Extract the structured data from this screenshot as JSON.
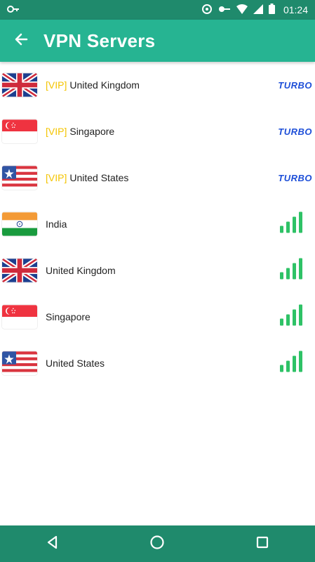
{
  "status_bar": {
    "time": "01:24",
    "icons": [
      "key-icon",
      "sync-icon",
      "vpn-key-icon",
      "wifi-icon",
      "signal-icon",
      "battery-icon"
    ]
  },
  "app_bar": {
    "title": "VPN Servers",
    "back_icon": "arrow-back-icon"
  },
  "colors": {
    "status_bar": "#1f8a6c",
    "app_bar": "#26b492",
    "vip": "#f4c400",
    "turbo": "#1e4fd8",
    "signal": "#2ec266"
  },
  "servers": [
    {
      "vip": "[VIP]",
      "name": "United Kingdom",
      "flag": "uk",
      "badge": "TURBO"
    },
    {
      "vip": "[VIP]",
      "name": "Singapore",
      "flag": "singapore",
      "badge": "TURBO"
    },
    {
      "vip": "[VIP]",
      "name": "United States",
      "flag": "us",
      "badge": "TURBO"
    },
    {
      "vip": "",
      "name": "India",
      "flag": "india",
      "badge": "signal"
    },
    {
      "vip": "",
      "name": "United Kingdom",
      "flag": "uk",
      "badge": "signal"
    },
    {
      "vip": "",
      "name": "Singapore",
      "flag": "singapore",
      "badge": "signal"
    },
    {
      "vip": "",
      "name": "United States",
      "flag": "us",
      "badge": "signal"
    }
  ],
  "nav_bar": [
    "back-triangle-icon",
    "home-circle-icon",
    "recents-square-icon"
  ]
}
